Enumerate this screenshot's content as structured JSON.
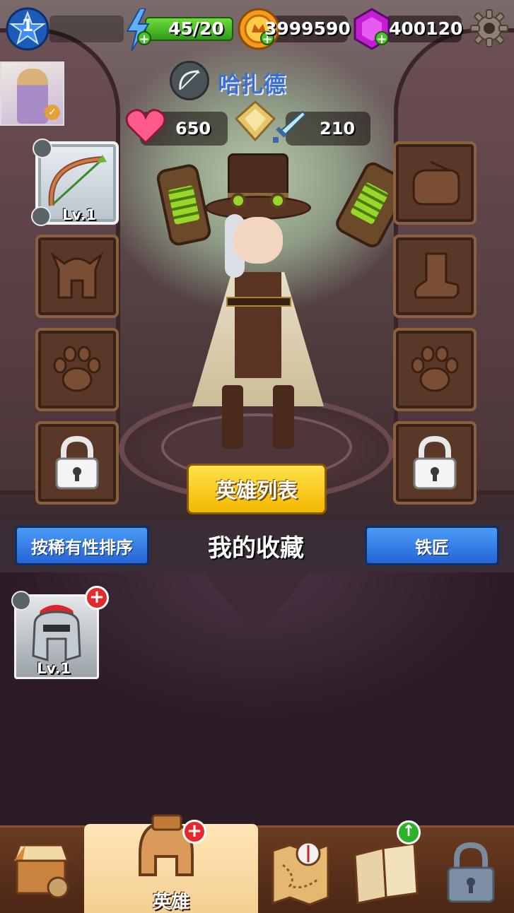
{
  "hud": {
    "player_level": "1",
    "energy": "45/20",
    "gold": "3999590",
    "gems": "400120"
  },
  "hero": {
    "name": "哈扎德",
    "hp": "650",
    "attack": "210"
  },
  "equipment": {
    "weapon_level": "Lv.1"
  },
  "actions": {
    "hero_list": "英雄列表",
    "sort_rarity": "按稀有性排序",
    "collection_title": "我的收藏",
    "blacksmith": "铁匠"
  },
  "collection": {
    "items": [
      {
        "level": "Lv.1"
      }
    ]
  },
  "nav": {
    "active_label": "英雄"
  },
  "colors": {
    "accent_yellow": "#f3b800",
    "button_blue": "#2664d6",
    "hero_name_blue": "#3b6fd6"
  }
}
